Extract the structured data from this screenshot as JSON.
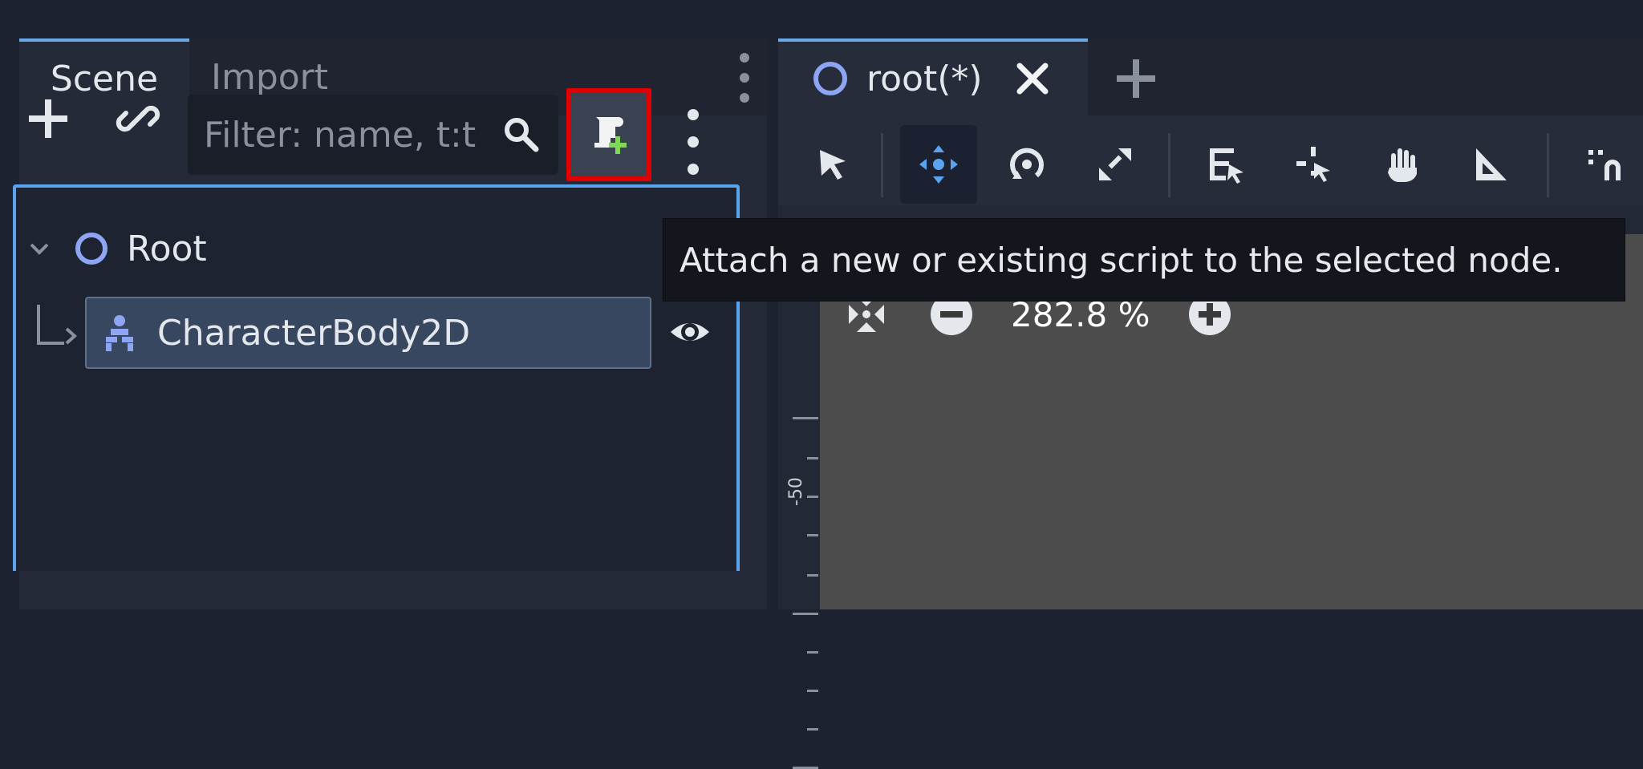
{
  "scene_dock": {
    "tabs": [
      {
        "label": "Scene",
        "active": true
      },
      {
        "label": "Import",
        "active": false
      }
    ],
    "toolbar": {
      "filter_placeholder": "Filter: name, t:t"
    },
    "tree": {
      "root": {
        "label": "Root"
      },
      "child": {
        "label": "CharacterBody2D",
        "selected": true
      }
    }
  },
  "viewport": {
    "tab": {
      "label": "root(*)"
    },
    "ruler_label": "-50",
    "zoom": {
      "value": "282.8 %"
    }
  },
  "tooltip": {
    "text": "Attach a new or existing script to the selected node."
  },
  "colors": {
    "accent": "#5aa3ee",
    "highlight_border": "#e00000",
    "node_icon": "#8da5f3",
    "selection": "#36475f"
  },
  "icons": [
    "add-node-icon",
    "link-icon",
    "search-icon",
    "attach-script-icon",
    "kebab-menu-icon",
    "chevron-down-icon",
    "ring-node-icon",
    "character-body-icon",
    "visibility-eye-icon",
    "close-icon",
    "plus-icon",
    "select-tool-icon",
    "move-tool-icon",
    "rotate-tool-icon",
    "scale-tool-icon",
    "list-select-icon",
    "pivot-icon",
    "pan-hand-icon",
    "ruler-icon",
    "snap-icon",
    "zoom-reset-icon",
    "zoom-out-icon",
    "zoom-in-icon"
  ]
}
